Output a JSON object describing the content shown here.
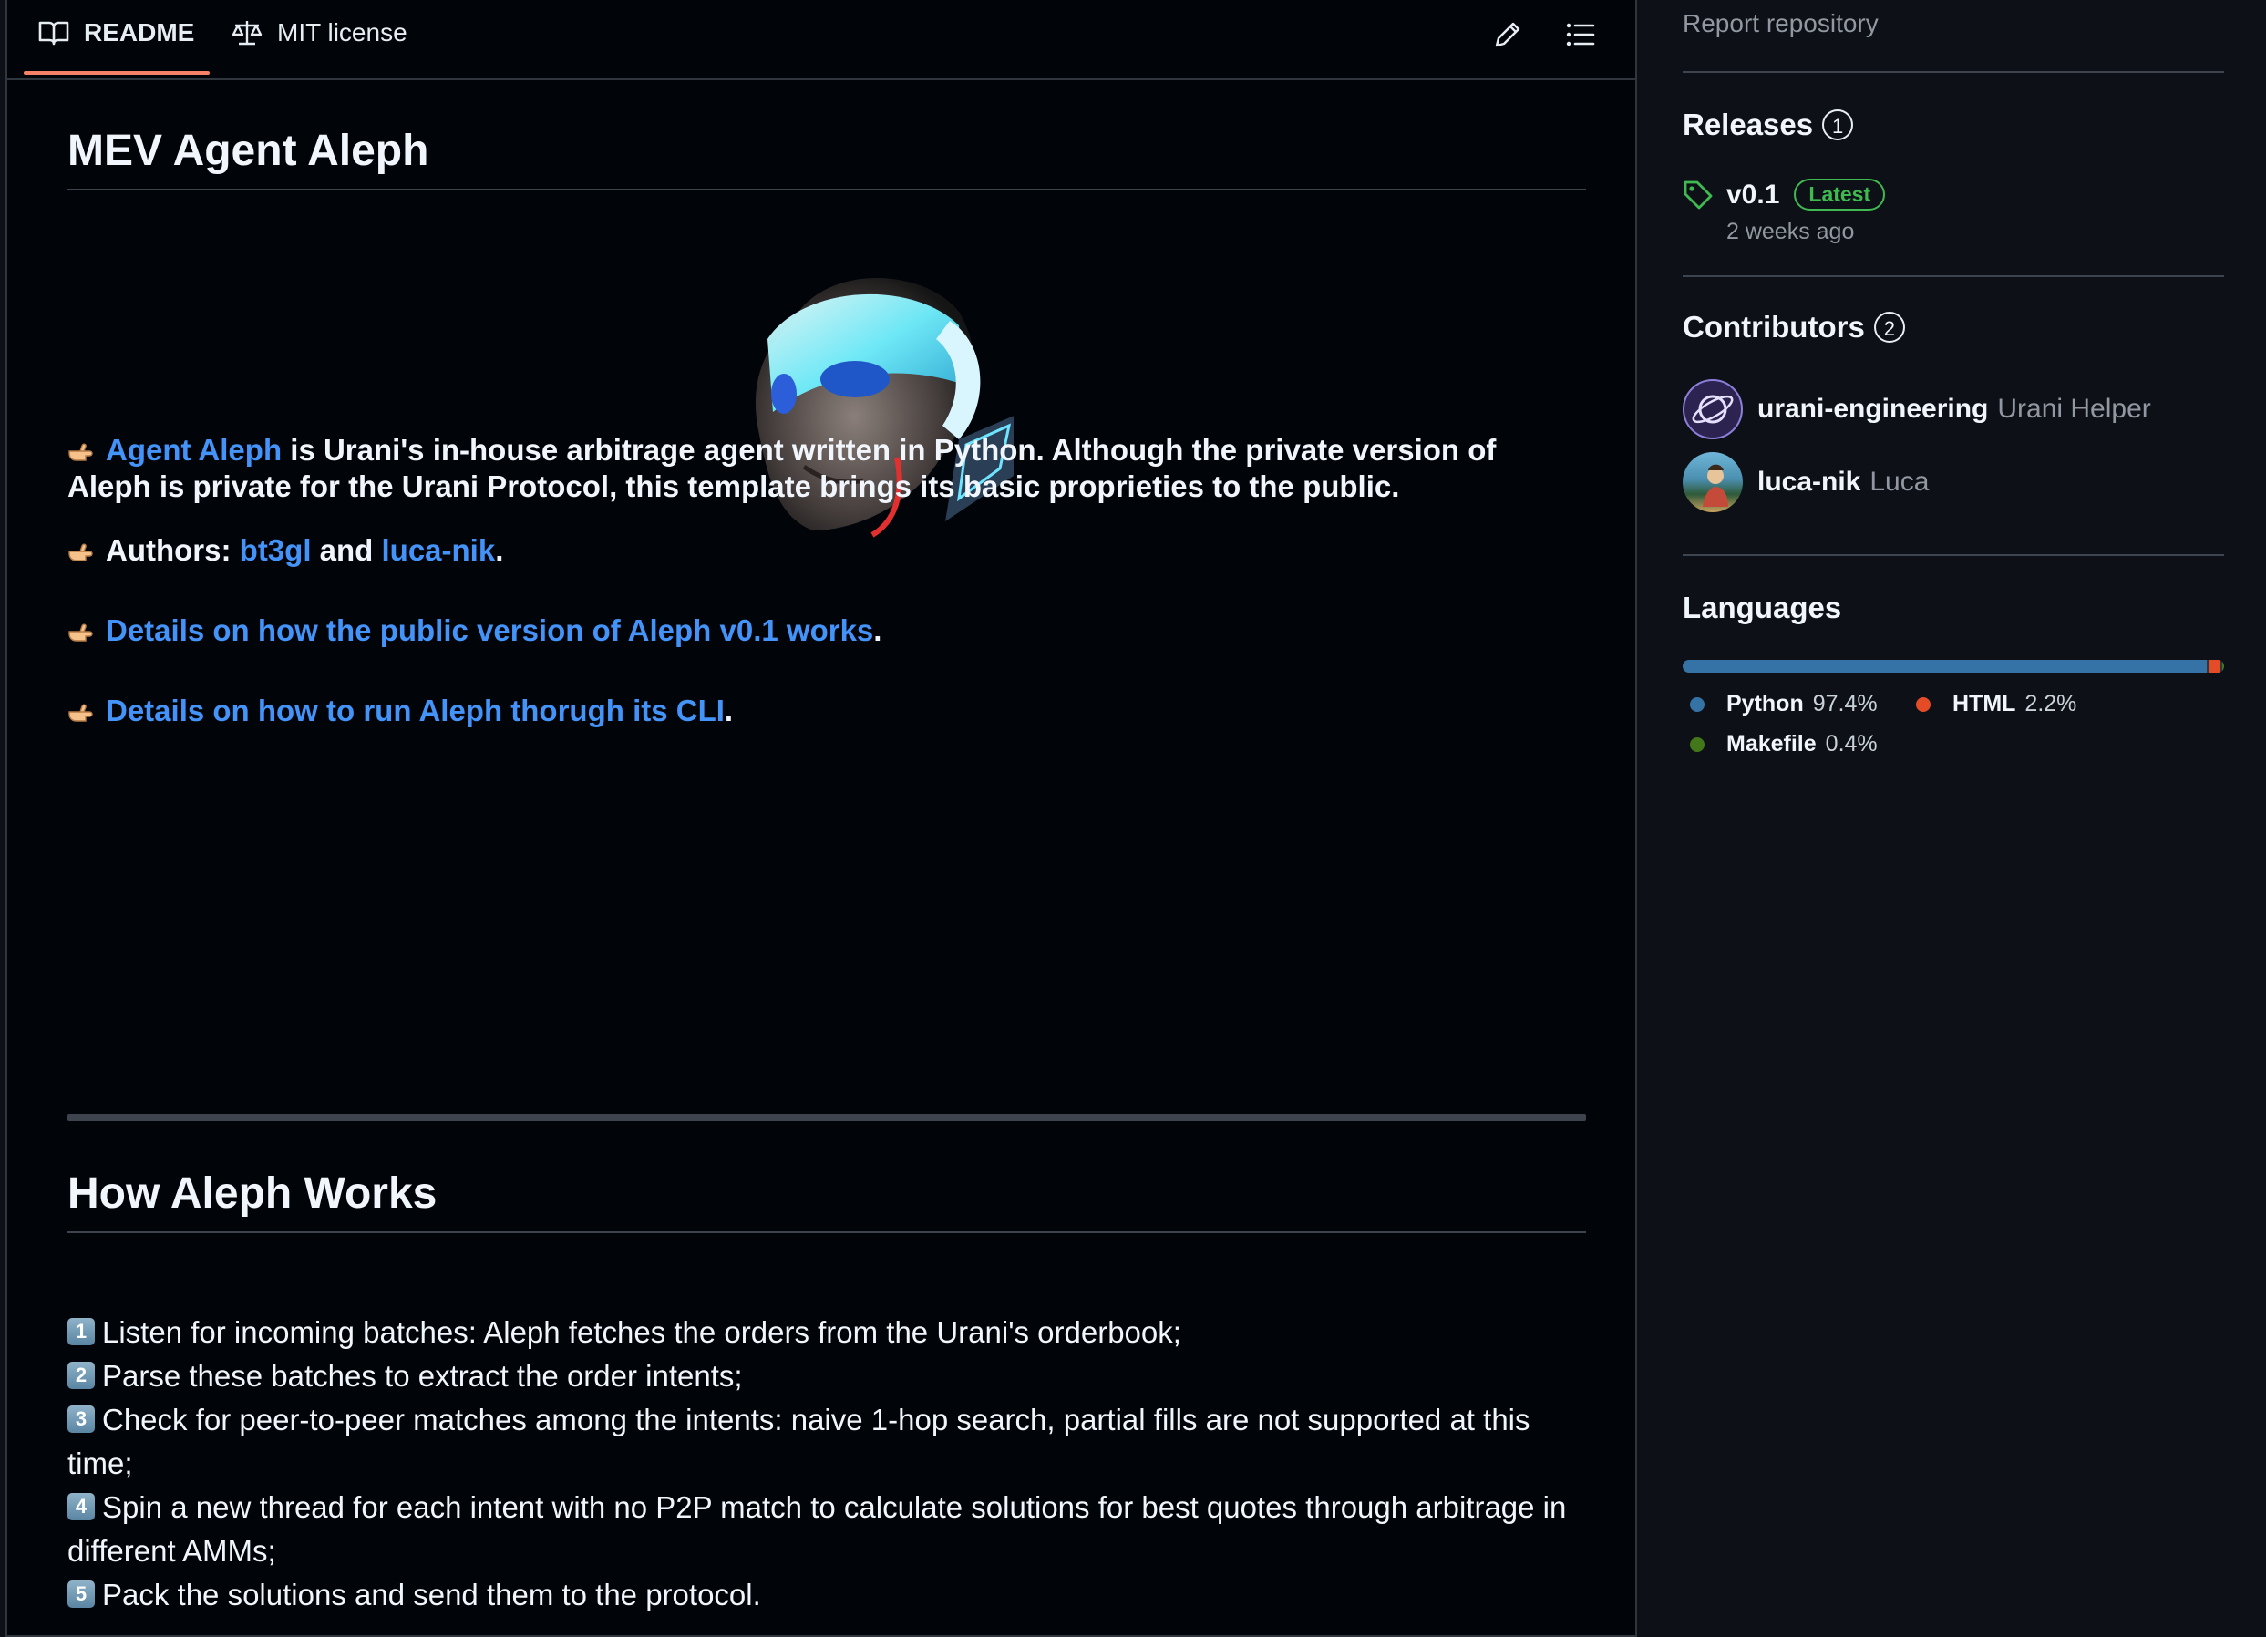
{
  "readme": {
    "tabs": {
      "readme_label": "README",
      "license_label": "MIT license"
    },
    "title": "MEV Agent Aleph",
    "intro": {
      "link": "Agent Aleph",
      "text": " is Urani's in-house arbitrage agent written in Python. Although the private version of Aleph is private for the Urani Protocol, this template brings its basic proprieties to the public."
    },
    "authors": {
      "prefix": "Authors: ",
      "author1": "bt3gl",
      "and": " and ",
      "author2": "luca-nik",
      "end": "."
    },
    "link1": {
      "text": "Details on how the public version of Aleph v0.1 works",
      "end": "."
    },
    "link2": {
      "text": "Details on how to run Aleph thorugh its CLI",
      "end": "."
    },
    "section_title": "How Aleph Works",
    "steps": [
      {
        "num": "1",
        "text": "Listen for incoming batches: Aleph fetches the orders from the Urani's orderbook;"
      },
      {
        "num": "2",
        "text": "Parse these batches to extract the order intents;"
      },
      {
        "num": "3",
        "text": "Check for peer-to-peer matches among the intents: naive 1-hop search, partial fills are not supported at this time;"
      },
      {
        "num": "4",
        "text": "Spin a new thread for each intent with no P2P match to calculate solutions for best quotes through arbitrage in different AMMs;"
      },
      {
        "num": "5",
        "text": "Pack the solutions and send them to the protocol."
      }
    ]
  },
  "sidebar": {
    "report": "Report repository",
    "releases": {
      "title": "Releases",
      "count": "1",
      "version": "v0.1",
      "badge": "Latest",
      "date": "2 weeks ago"
    },
    "contributors": {
      "title": "Contributors",
      "count": "2",
      "items": [
        {
          "login": "urani-engineering",
          "name": "Urani Helper"
        },
        {
          "login": "luca-nik",
          "name": "Luca"
        }
      ]
    },
    "languages": {
      "title": "Languages",
      "items": [
        {
          "name": "Python",
          "percent": "97.4%",
          "color": "#3572A5",
          "value": 97.4
        },
        {
          "name": "HTML",
          "percent": "2.2%",
          "color": "#e34c26",
          "value": 2.2
        },
        {
          "name": "Makefile",
          "percent": "0.4%",
          "color": "#427819",
          "value": 0.4
        }
      ]
    }
  }
}
